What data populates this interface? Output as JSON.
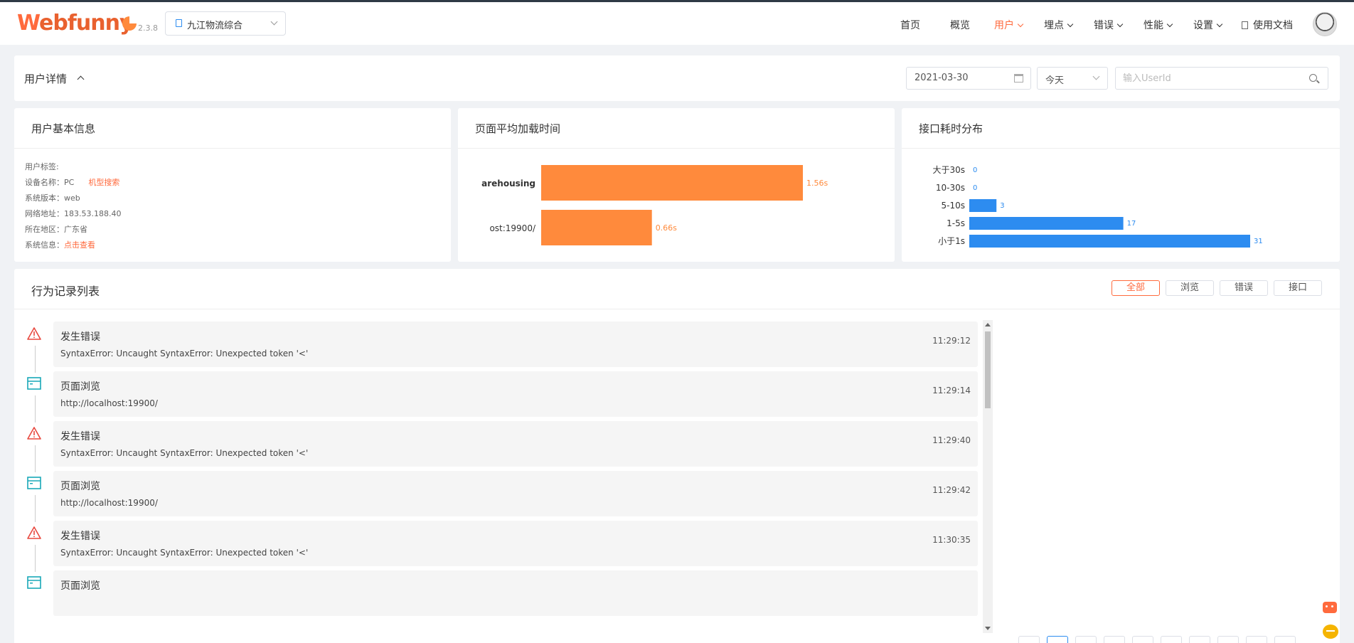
{
  "header": {
    "logo_w": "W",
    "logo_rest": "ebfunny",
    "version": "2.3.8",
    "project": "九江物流综合",
    "nav": [
      {
        "label": "首页",
        "dropdown": false,
        "active": false
      },
      {
        "label": "概览",
        "dropdown": false,
        "active": false
      },
      {
        "label": "用户",
        "dropdown": true,
        "active": true
      },
      {
        "label": "埋点",
        "dropdown": true,
        "active": false
      },
      {
        "label": "错误",
        "dropdown": true,
        "active": false
      },
      {
        "label": "性能",
        "dropdown": true,
        "active": false
      },
      {
        "label": "设置",
        "dropdown": true,
        "active": false
      }
    ],
    "docs": "使用文档"
  },
  "filter_bar": {
    "title": "用户详情",
    "date": "2021-03-30",
    "range": "今天",
    "userid_placeholder": "输入UserId"
  },
  "user_info": {
    "title": "用户基本信息",
    "tag_label": "用户标签:",
    "device_label": "设备名称：",
    "device_value": "PC",
    "device_link": "机型搜索",
    "os_label": "系统版本：",
    "os_value": "web",
    "ip_label": "网络地址：",
    "ip_value": "183.53.188.40",
    "region_label": "所在地区：",
    "region_value": "广东省",
    "sysinfo_label": "系统信息：",
    "sysinfo_link": "点击查看"
  },
  "page_load": {
    "title": "页面平均加载时间"
  },
  "api_dist": {
    "title": "接口耗时分布"
  },
  "chart_data": [
    {
      "type": "bar",
      "orientation": "horizontal",
      "categories": [
        "arehousing",
        "ost:19900/"
      ],
      "values": [
        1.56,
        0.66
      ],
      "value_labels": [
        "1.56s",
        "0.66s"
      ],
      "unit": "s",
      "color": "#ff8a3c",
      "xlim": [
        0,
        1.56
      ]
    },
    {
      "type": "bar",
      "orientation": "horizontal",
      "categories": [
        "大于30s",
        "10-30s",
        "5-10s",
        "1-5s",
        "小于1s"
      ],
      "values": [
        0,
        0,
        3,
        17,
        31
      ],
      "color": "#2d8cf0",
      "xlim": [
        0,
        31
      ]
    }
  ],
  "records": {
    "title": "行为记录列表",
    "filters": [
      "全部",
      "浏览",
      "错误",
      "接口"
    ],
    "active_filter": "全部",
    "items": [
      {
        "kind": "error",
        "title": "发生错误",
        "detail": "SyntaxError: Uncaught SyntaxError: Unexpected token '<'",
        "time": "11:29:12"
      },
      {
        "kind": "page",
        "title": "页面浏览",
        "detail": "http://localhost:19900/",
        "time": "11:29:14"
      },
      {
        "kind": "error",
        "title": "发生错误",
        "detail": "SyntaxError: Uncaught SyntaxError: Unexpected token '<'",
        "time": "11:29:40"
      },
      {
        "kind": "page",
        "title": "页面浏览",
        "detail": "http://localhost:19900/",
        "time": "11:29:42"
      },
      {
        "kind": "error",
        "title": "发生错误",
        "detail": "SyntaxError: Uncaught SyntaxError: Unexpected token '<'",
        "time": "11:30:35"
      },
      {
        "kind": "page",
        "title": "页面浏览",
        "detail": "",
        "time": ""
      }
    ]
  },
  "colors": {
    "accent": "#ff6a3d",
    "bar_orange": "#ff8a3c",
    "bar_blue": "#2d8cf0",
    "error_red": "#e8483f",
    "page_teal": "#19a8b8"
  }
}
